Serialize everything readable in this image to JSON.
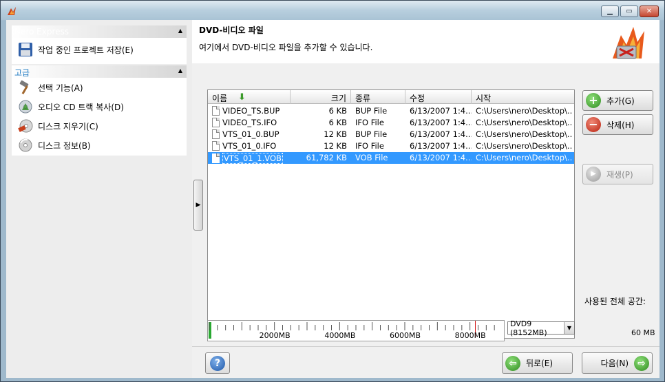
{
  "left": {
    "group1": {
      "title": "Nero Express",
      "items": [
        {
          "label": "작업 중인 프로젝트 저장(E)",
          "icon": "floppy-disk-icon"
        }
      ]
    },
    "group2": {
      "title": "고급",
      "items": [
        {
          "label": "선택 기능(A)",
          "icon": "hammer-icon"
        },
        {
          "label": "오디오 CD 트랙 복사(D)",
          "icon": "audio-cd-icon"
        },
        {
          "label": "디스크 지우기(C)",
          "icon": "disc-erase-icon"
        },
        {
          "label": "디스크 정보(B)",
          "icon": "disc-info-icon"
        }
      ]
    }
  },
  "header": {
    "title": "DVD-비디오 파일",
    "subtitle": "여기에서 DVD-비디오 파일을 추가할 수 있습니다."
  },
  "list": {
    "columns": [
      "이름",
      "크기",
      "종류",
      "수정",
      "시작"
    ],
    "rows": [
      {
        "name": "VIDEO_TS.BUP",
        "size": "6 KB",
        "type": "BUP File",
        "modified": "6/13/2007 1:4...",
        "origin": "C:\\Users\\nero\\Desktop\\..."
      },
      {
        "name": "VIDEO_TS.IFO",
        "size": "6 KB",
        "type": "IFO File",
        "modified": "6/13/2007 1:4...",
        "origin": "C:\\Users\\nero\\Desktop\\..."
      },
      {
        "name": "VTS_01_0.BUP",
        "size": "12 KB",
        "type": "BUP File",
        "modified": "6/13/2007 1:4...",
        "origin": "C:\\Users\\nero\\Desktop\\..."
      },
      {
        "name": "VTS_01_0.IFO",
        "size": "12 KB",
        "type": "IFO File",
        "modified": "6/13/2007 1:4...",
        "origin": "C:\\Users\\nero\\Desktop\\..."
      },
      {
        "name": "VTS_01_1.VOB",
        "size": "61,782 KB",
        "type": "VOB File",
        "modified": "6/13/2007 1:4...",
        "origin": "C:\\Users\\nero\\Desktop\\...",
        "selected": true
      }
    ]
  },
  "buttons": {
    "add": "추가(G)",
    "delete": "삭제(H)",
    "play": "재생(P)",
    "back": "뒤로(E)",
    "next": "다음(N)"
  },
  "space": {
    "label": "사용된 전체 공간:",
    "value": "60 MB",
    "used_mb": 60,
    "capacity_mb": 8152
  },
  "capacity": {
    "labels": [
      "2000MB",
      "4000MB",
      "6000MB",
      "8000MB"
    ],
    "disc": "DVD9 (8152MB)"
  },
  "colors": {
    "selection": "#3399ff",
    "fill": "#2aa832",
    "limit": "#d21a1a",
    "section_title": "#1a78c2"
  }
}
